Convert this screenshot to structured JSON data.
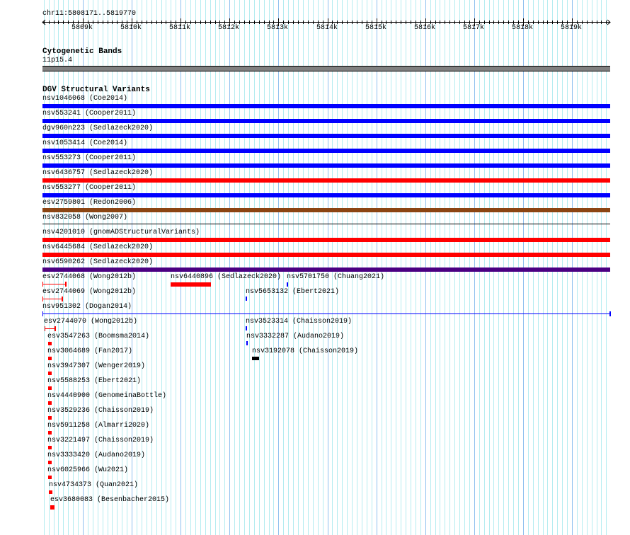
{
  "ruler": {
    "position": "chr11:5808171..5819770",
    "ticks": [
      "5809k",
      "5810k",
      "5811k",
      "5812k",
      "5813k",
      "5814k",
      "5815k",
      "5816k",
      "5817k",
      "5818k",
      "5819k"
    ]
  },
  "cyto": {
    "title": "Cytogenetic Bands",
    "band": "11p15.4",
    "color": "#808080"
  },
  "dgv": {
    "title": "DGV Structural Variants",
    "full_rows": [
      {
        "label": "nsv1046068 (Coe2014)",
        "color": "#0000ff"
      },
      {
        "label": "nsv553241 (Cooper2011)",
        "color": "#0000ff"
      },
      {
        "label": "dgv960n223 (Sedlazeck2020)",
        "color": "#0000ff"
      },
      {
        "label": "nsv1053414 (Coe2014)",
        "color": "#0000ff"
      },
      {
        "label": "nsv553273 (Cooper2011)",
        "color": "#0000ff"
      },
      {
        "label": "nsv6436757 (Sedlazeck2020)",
        "color": "#ff0000"
      },
      {
        "label": "nsv553277 (Cooper2011)",
        "color": "#0000ff"
      },
      {
        "label": "esv2759801 (Redon2006)",
        "color": "#8b4513"
      },
      {
        "label": "nsv832058 (Wong2007)",
        "color": "#000000"
      },
      {
        "label": "nsv4201010 (gnomADStructuralVariants)",
        "color": "#ff0000"
      },
      {
        "label": "nsv6445684 (Sedlazeck2020)",
        "color": "#ff0000"
      },
      {
        "label": "nsv6590262 (Sedlazeck2020)",
        "color": "#4b0082"
      }
    ],
    "items": [
      {
        "label": "esv2744068 (Wong2012b)",
        "color": "#ff0000"
      },
      {
        "label": "nsv6440896 (Sedlazeck2020)",
        "color": "#ff0000"
      },
      {
        "label": "nsv5701750 (Chuang2021)",
        "color": "#0000ff"
      },
      {
        "label": "esv2744069 (Wong2012b)",
        "color": "#ff0000"
      },
      {
        "label": "nsv5653132 (Ebert2021)",
        "color": "#0000ff"
      },
      {
        "label": "nsv951302 (Dogan2014)",
        "color": "#0000ff"
      },
      {
        "label": "esv2744070 (Wong2012b)",
        "color": "#ff0000"
      },
      {
        "label": "nsv3523314 (Chaisson2019)",
        "color": "#0000ff"
      },
      {
        "label": "esv3547263 (Boomsma2014)",
        "color": "#ff0000"
      },
      {
        "label": "nsv3332287 (Audano2019)",
        "color": "#0000ff"
      },
      {
        "label": "nsv3064689 (Fan2017)",
        "color": "#ff0000"
      },
      {
        "label": "nsv3192078 (Chaisson2019)",
        "color": "#000000"
      },
      {
        "label": "nsv3947307 (Wenger2019)",
        "color": "#ff0000"
      },
      {
        "label": "nsv5588253 (Ebert2021)",
        "color": "#ff0000"
      },
      {
        "label": "nsv4440900 (GenomeinaBottle)",
        "color": "#ff0000"
      },
      {
        "label": "nsv3529236 (Chaisson2019)",
        "color": "#ff0000"
      },
      {
        "label": "nsv5911258 (Almarri2020)",
        "color": "#ff0000"
      },
      {
        "label": "nsv3221497 (Chaisson2019)",
        "color": "#ff0000"
      },
      {
        "label": "nsv3333420 (Audano2019)",
        "color": "#ff0000"
      },
      {
        "label": "nsv6025966 (Wu2021)",
        "color": "#ff0000"
      },
      {
        "label": "nsv4734373 (Quan2021)",
        "color": "#ff0000"
      },
      {
        "label": "esv3680083 (Besenbacher2015)",
        "color": "#ff0000"
      }
    ]
  }
}
